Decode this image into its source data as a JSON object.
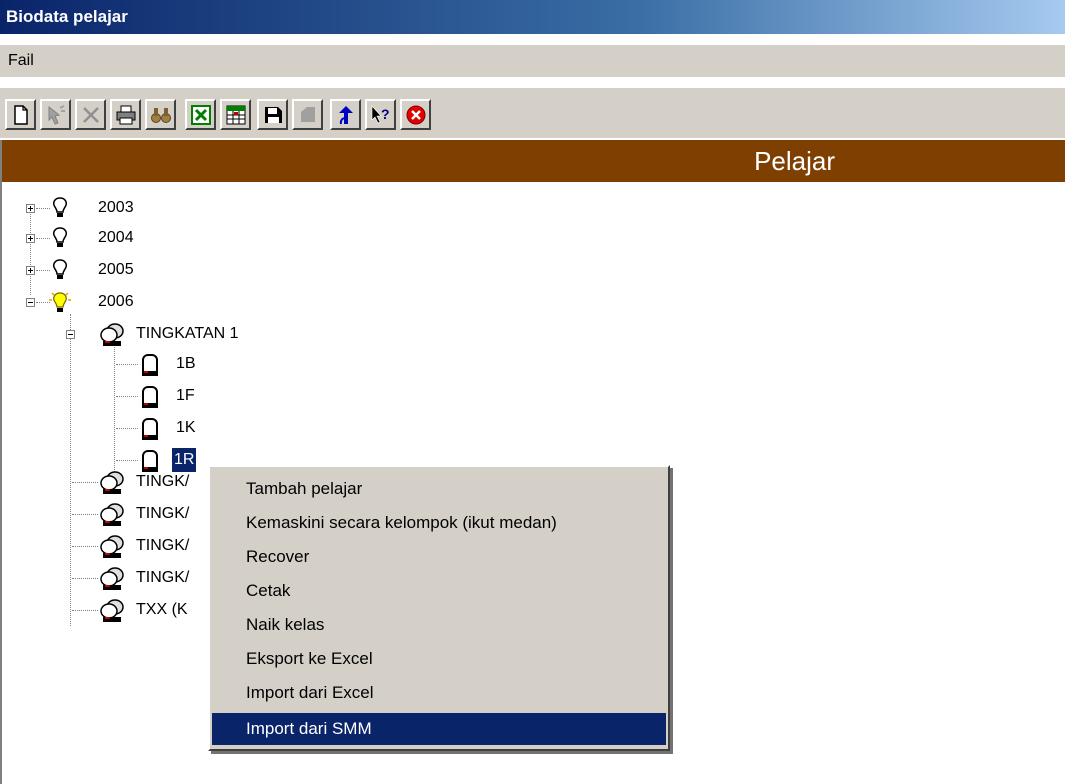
{
  "window": {
    "title": "Biodata pelajar"
  },
  "menu": {
    "items": [
      "Fail"
    ]
  },
  "toolbar": {
    "buttons": [
      {
        "icon": "new-document-icon"
      },
      {
        "icon": "pointer-icon"
      },
      {
        "icon": "delete-icon"
      },
      {
        "icon": "printer-icon"
      },
      {
        "icon": "binoculars-icon"
      },
      {
        "icon": "excel-icon"
      },
      {
        "icon": "excel-grid-icon"
      },
      {
        "icon": "save-icon"
      },
      {
        "icon": "gray-shape-icon"
      },
      {
        "icon": "move-up-icon"
      },
      {
        "icon": "help-icon"
      },
      {
        "icon": "exit-icon"
      }
    ]
  },
  "header": {
    "title": "Pelajar",
    "color": "#7f3f00"
  },
  "tree": {
    "years": [
      "2003",
      "2004",
      "2005",
      "2006"
    ],
    "tingkatan": [
      "TINGKATAN 1",
      "TINGK/",
      "TINGK/",
      "TINGK/",
      "TINGK/",
      "TXX (K"
    ],
    "classes": [
      "1B",
      "1F",
      "1K",
      "1R"
    ]
  },
  "context_menu": {
    "items": [
      "Tambah pelajar",
      "Kemaskini secara kelompok (ikut medan)",
      "Recover",
      "Cetak",
      "Naik kelas",
      "Eksport ke Excel",
      "Import dari Excel",
      "Import dari SMM"
    ],
    "highlighted_index": 7,
    "highlight_color": "#0a246a"
  }
}
